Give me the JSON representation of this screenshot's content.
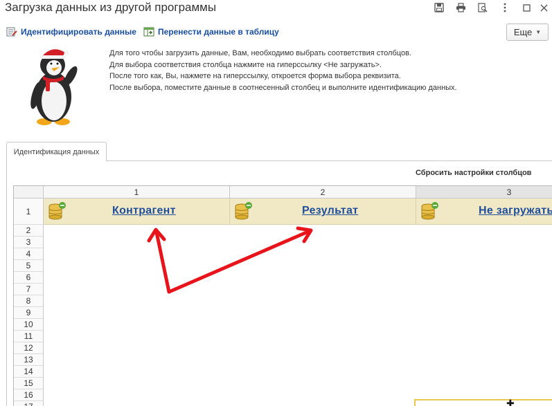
{
  "window": {
    "title": "Загрузка данных из другой программы"
  },
  "toolbar": {
    "identify_label": "Идентифицировать данные",
    "transfer_label": "Перенести данные в таблицу",
    "more_label": "Еще"
  },
  "info": {
    "lines": [
      "Для того чтобы загрузить данные, Вам, необходимо выбрать соответствия столбцов.",
      "Для выбора соответствия столбца нажмите на гиперссылку <Не загружать>.",
      "После того как, Вы, нажмете на гиперссылку, откроется форма выбора реквизита.",
      "После выбора, поместите данные в соотнесенный столбец и выполните идентификацию данных."
    ]
  },
  "tabs": [
    {
      "label": "Идентификация данных"
    }
  ],
  "reset_link": "Сбросить настройки столбцов",
  "grid": {
    "columns": [
      "1",
      "2",
      "3"
    ],
    "column_mappings": [
      "Контрагент",
      "Результат",
      "Не загружать"
    ],
    "rows": [
      "1",
      "2",
      "3",
      "4",
      "5",
      "6",
      "7",
      "8",
      "9",
      "10",
      "11",
      "12",
      "13",
      "14",
      "15",
      "16",
      "17"
    ]
  },
  "colors": {
    "link": "#1f4e9a",
    "header_cell": "#f1e8c6",
    "arrow": "#e8141b",
    "selection": "#e8c84a"
  }
}
